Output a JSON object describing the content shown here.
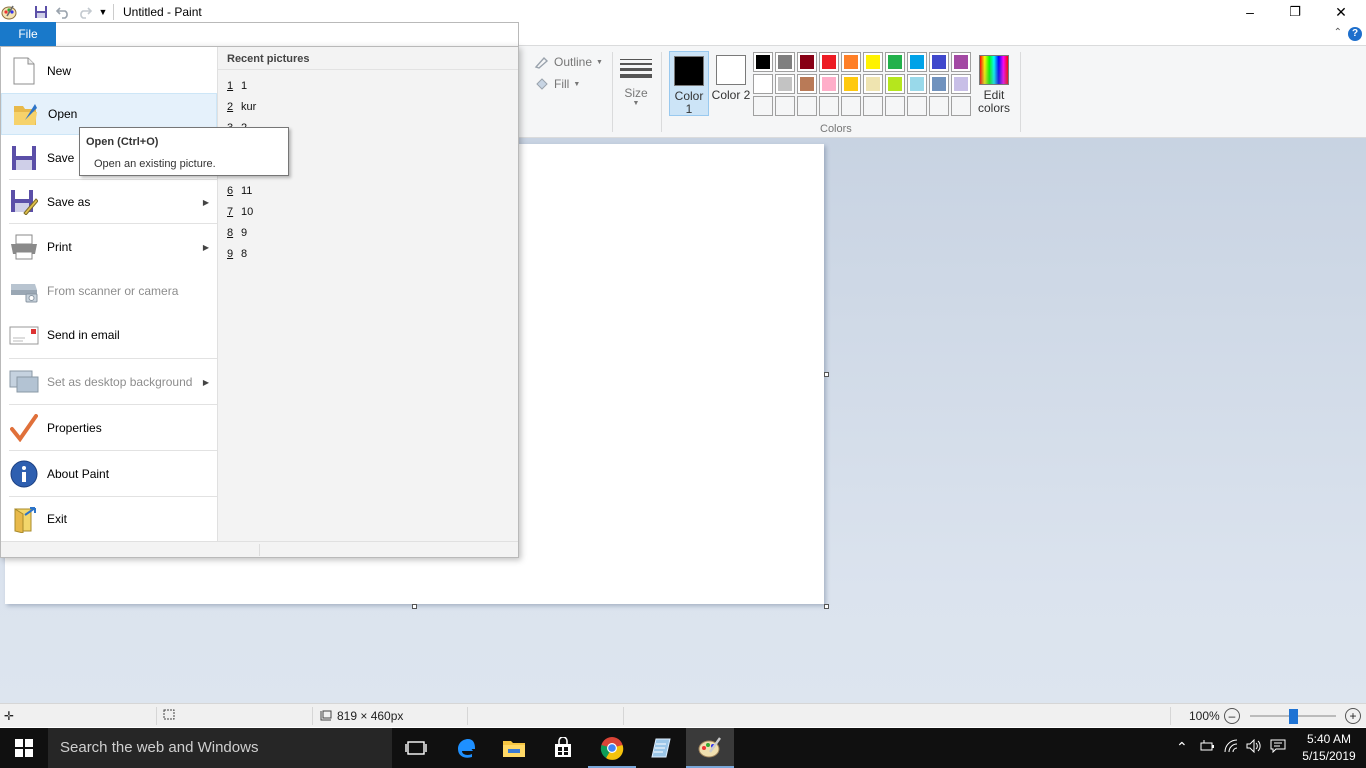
{
  "window": {
    "title": "Untitled - Paint",
    "controls": {
      "minimize": "–",
      "maximize": "❐",
      "close": "✕"
    }
  },
  "quick_access": [
    "paint-app-icon",
    "save-icon",
    "undo-icon",
    "redo-icon",
    "customize-dropdown-icon"
  ],
  "ribbon": {
    "file_tab": "File",
    "outline_label": "Outline",
    "fill_label": "Fill",
    "size_label": "Size",
    "color1_label": "Color 1",
    "color2_label": "Color 2",
    "color1_value": "#000000",
    "color2_value": "#ffffff",
    "edit_colors_label": "Edit colors",
    "colors_group_label": "Colors",
    "palette": [
      "#000000",
      "#7f7f7f",
      "#880015",
      "#ed1c24",
      "#ff7f27",
      "#fff200",
      "#22b14c",
      "#00a2e8",
      "#3f48cc",
      "#a349a4",
      "#ffffff",
      "#c3c3c3",
      "#b97a57",
      "#ffaec9",
      "#ffc90e",
      "#efe4b0",
      "#b5e61d",
      "#99d9ea",
      "#7092be",
      "#c8bfe7",
      "",
      "",
      "",
      "",
      "",
      "",
      "",
      "",
      "",
      ""
    ]
  },
  "file_menu": {
    "items": [
      {
        "label": "New",
        "icon": "new-document-icon"
      },
      {
        "label": "Open",
        "icon": "open-folder-icon"
      },
      {
        "label": "Save",
        "icon": "save-disk-icon"
      },
      {
        "label": "Save as",
        "icon": "save-as-icon"
      },
      {
        "label": "Print",
        "icon": "printer-icon"
      },
      {
        "label": "From scanner or camera",
        "icon": "scanner-icon"
      },
      {
        "label": "Send in email",
        "icon": "email-icon"
      },
      {
        "label": "Set as desktop background",
        "icon": "desktop-background-icon"
      },
      {
        "label": "Properties",
        "icon": "checkmark-icon"
      },
      {
        "label": "About Paint",
        "icon": "info-icon"
      },
      {
        "label": "Exit",
        "icon": "exit-icon"
      }
    ],
    "recent_title": "Recent pictures",
    "recent": [
      {
        "num": "1",
        "name": "1"
      },
      {
        "num": "2",
        "name": "kur"
      },
      {
        "num": "3",
        "name": "2"
      },
      {
        "num": "6",
        "name": "11"
      },
      {
        "num": "7",
        "name": "10"
      },
      {
        "num": "8",
        "name": "9"
      },
      {
        "num": "9",
        "name": "8"
      }
    ]
  },
  "tooltip": {
    "title": "Open (Ctrl+O)",
    "description": "Open an existing picture."
  },
  "status_bar": {
    "canvas_size": "819 × 460px",
    "zoom": "100%",
    "zoom_fraction": 0.5
  },
  "taskbar": {
    "search_placeholder": "Search the web and Windows",
    "time": "5:40 AM",
    "date": "5/15/2019"
  }
}
